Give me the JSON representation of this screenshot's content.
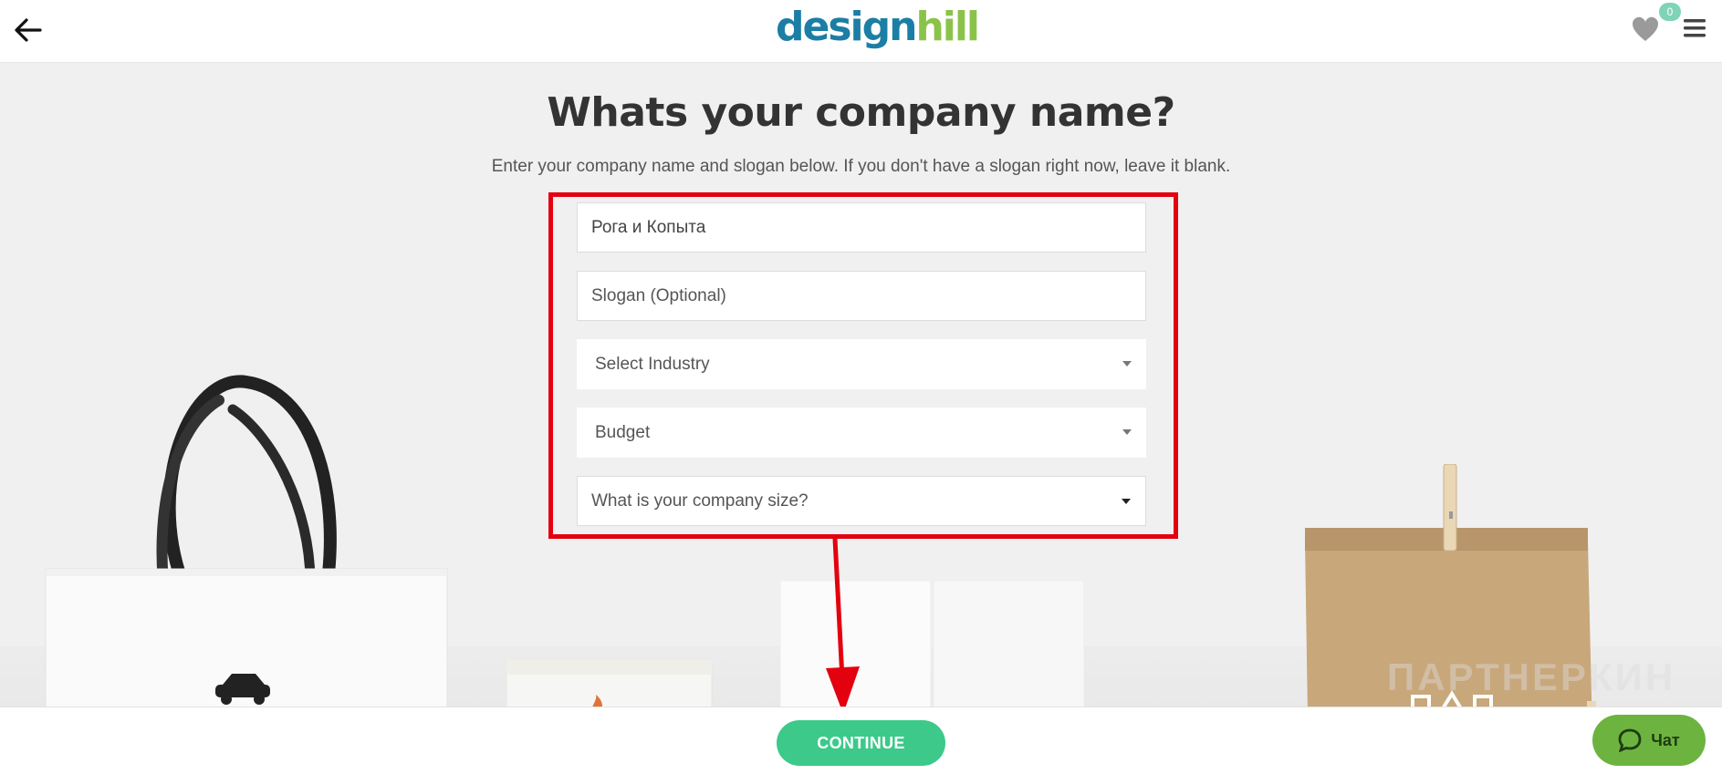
{
  "header": {
    "logo_part1": "design",
    "logo_part2": "hill",
    "favorites_count": "0"
  },
  "main": {
    "title": "Whats your company name?",
    "subtitle": "Enter your company name and slogan below. If you don't have a slogan right now, leave it blank."
  },
  "form": {
    "company_name_value": "Рога и Копыта",
    "slogan_placeholder": "Slogan (Optional)",
    "industry_label": "Select Industry",
    "budget_label": "Budget",
    "company_size_label": "What is your company size?"
  },
  "footer": {
    "continue_label": "CONTINUE",
    "chat_label": "Чат"
  },
  "watermark": "ПАРТНЕРКИН",
  "colors": {
    "accent_green": "#3cc98a",
    "logo_blue": "#1c7ea5",
    "logo_green": "#8bc34a",
    "highlight_red": "#e3000f",
    "chat_green": "#6cb43f"
  }
}
